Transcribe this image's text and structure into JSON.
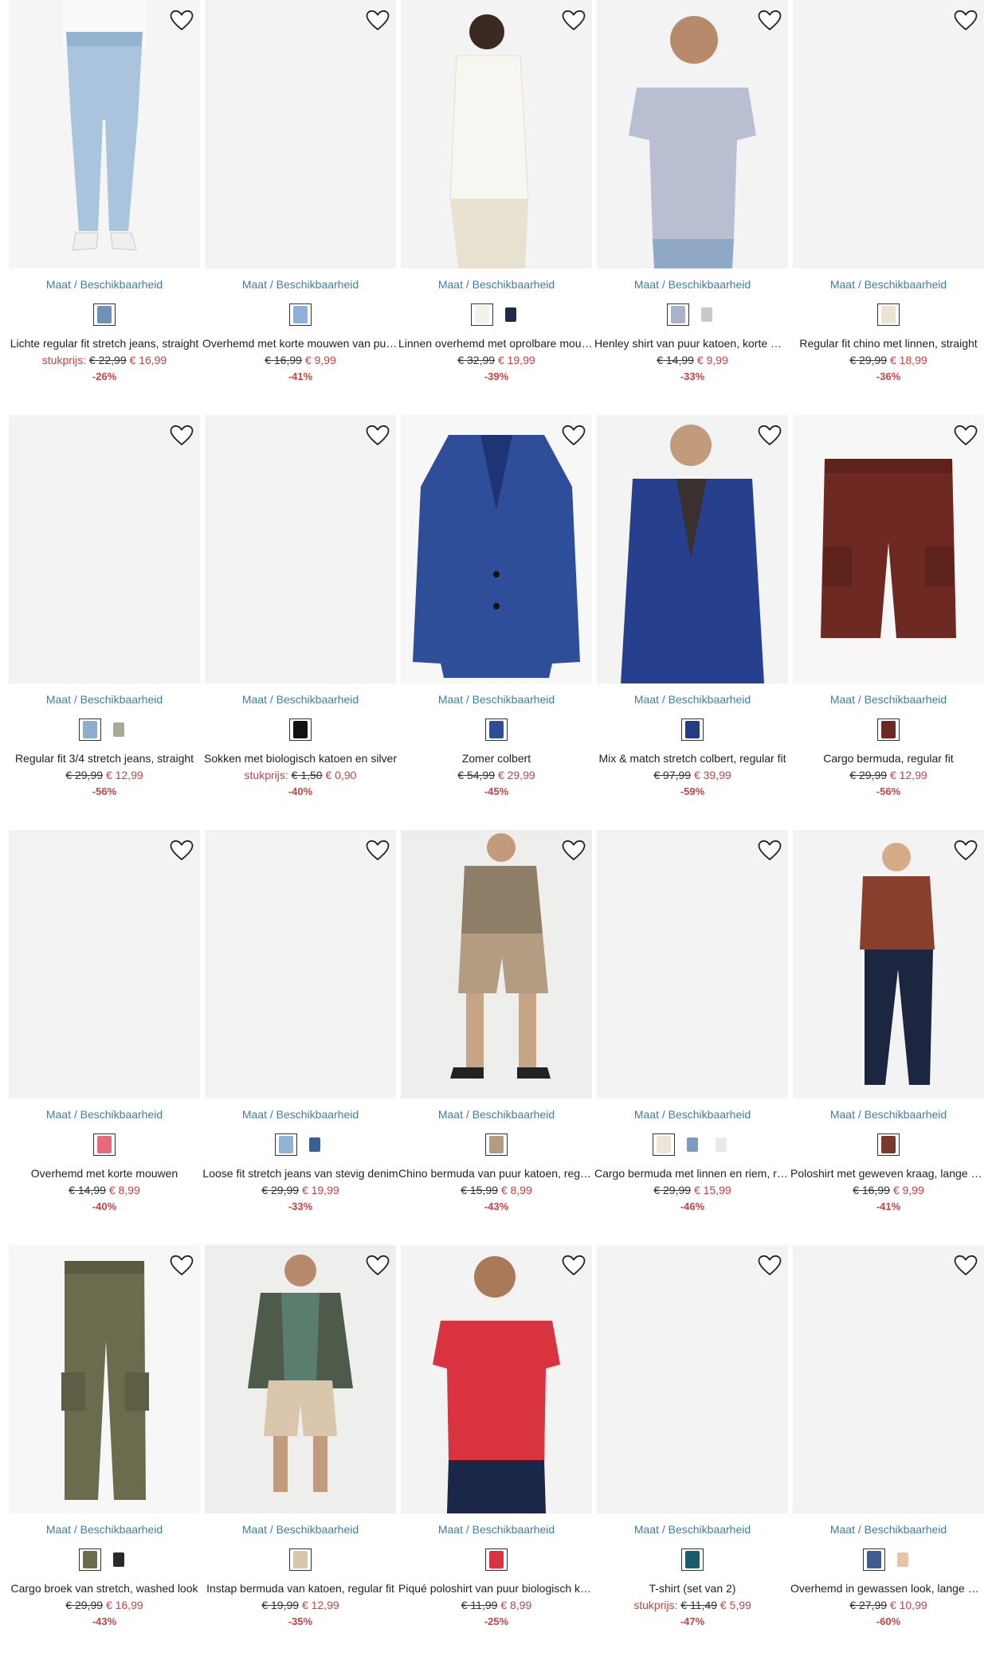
{
  "size_link_label": "Maat / Beschikbaarheid",
  "colors": {
    "link": "#3d7ea6",
    "sale": "#c14545",
    "placeholder": "#f3f3f3"
  },
  "products": [
    {
      "name": "Lichte regular fit stretch jeans, straight",
      "unit_label": "stukprijs:",
      "old_price": "€ 22,99",
      "new_price": "€ 16,99",
      "discount": "-26%",
      "image": "light-blue-jeans-model",
      "swatches": [
        "#6f92b8"
      ]
    },
    {
      "name": "Overhemd met korte mouwen van puur katoen",
      "unit_label": "",
      "old_price": "€ 16,99",
      "new_price": "€ 9,99",
      "discount": "-41%",
      "image": "placeholder",
      "swatches": [
        "#8fb0d8"
      ]
    },
    {
      "name": "Linnen overhemd met oprolbare mouwen",
      "unit_label": "",
      "old_price": "€ 32,99",
      "new_price": "€ 19,99",
      "discount": "-39%",
      "image": "white-linen-shirt-model",
      "swatches": [
        "#f4f1ea",
        "#1f2a44"
      ]
    },
    {
      "name": "Henley shirt van puur katoen, korte mouw",
      "unit_label": "",
      "old_price": "€ 14,99",
      "new_price": "€ 9,99",
      "discount": "-33%",
      "image": "grey-henley-model",
      "swatches": [
        "#a9b2c6",
        "#c9c9c9"
      ]
    },
    {
      "name": "Regular fit chino met linnen, straight",
      "unit_label": "",
      "old_price": "€ 29,99",
      "new_price": "€ 18,99",
      "discount": "-36%",
      "image": "placeholder",
      "swatches": [
        "#ece4d2"
      ]
    },
    {
      "name": "Regular fit 3/4 stretch jeans, straight",
      "unit_label": "",
      "old_price": "€ 29,99",
      "new_price": "€ 12,99",
      "discount": "-56%",
      "image": "placeholder",
      "swatches": [
        "#8eaed0",
        "#a9aa98"
      ]
    },
    {
      "name": "Sokken met biologisch katoen en silver",
      "unit_label": "stukprijs:",
      "old_price": "€ 1,50",
      "new_price": "€ 0,90",
      "discount": "-40%",
      "image": "placeholder",
      "swatches": [
        "#111111"
      ]
    },
    {
      "name": "Zomer colbert",
      "unit_label": "",
      "old_price": "€ 54,99",
      "new_price": "€ 29,99",
      "discount": "-45%",
      "image": "blue-blazer",
      "swatches": [
        "#2e4d96"
      ]
    },
    {
      "name": "Mix & match stretch colbert, regular fit",
      "unit_label": "",
      "old_price": "€ 97,99",
      "new_price": "€ 39,99",
      "discount": "-59%",
      "image": "blue-suit-model",
      "swatches": [
        "#243c80"
      ]
    },
    {
      "name": "Cargo bermuda, regular fit",
      "unit_label": "",
      "old_price": "€ 29,99",
      "new_price": "€ 12,99",
      "discount": "-56%",
      "image": "brown-cargo-shorts",
      "swatches": [
        "#6e2a22"
      ]
    },
    {
      "name": "Overhemd met korte mouwen",
      "unit_label": "",
      "old_price": "€ 14,99",
      "new_price": "€ 8,99",
      "discount": "-40%",
      "image": "placeholder",
      "swatches": [
        "#e86a7a"
      ]
    },
    {
      "name": "Loose fit stretch jeans van stevig denim",
      "unit_label": "",
      "old_price": "€ 29,99",
      "new_price": "€ 19,99",
      "discount": "-33%",
      "image": "placeholder",
      "swatches": [
        "#8fb2d6",
        "#3a5f92"
      ]
    },
    {
      "name": "Chino bermuda van puur katoen, regular fit",
      "unit_label": "",
      "old_price": "€ 15,99",
      "new_price": "€ 8,99",
      "discount": "-43%",
      "image": "khaki-outfit-model",
      "swatches": [
        "#b49c82"
      ]
    },
    {
      "name": "Cargo bermuda met linnen en riem, regular",
      "unit_label": "",
      "old_price": "€ 29,99",
      "new_price": "€ 15,99",
      "discount": "-46%",
      "image": "placeholder",
      "swatches": [
        "#ece6d4",
        "#7d9ac0",
        "#e9e9e9"
      ]
    },
    {
      "name": "Poloshirt met geweven kraag, lange mouw",
      "unit_label": "",
      "old_price": "€ 16,99",
      "new_price": "€ 9,99",
      "discount": "-41%",
      "image": "rust-polo-model",
      "swatches": [
        "#7a3a2a"
      ]
    },
    {
      "name": "Cargo broek van stretch, washed look",
      "unit_label": "",
      "old_price": "€ 29,99",
      "new_price": "€ 16,99",
      "discount": "-43%",
      "image": "olive-cargo-pants",
      "swatches": [
        "#6b6b4e",
        "#2a2a2a"
      ]
    },
    {
      "name": "Instap bermuda van katoen, regular fit",
      "unit_label": "",
      "old_price": "€ 19,99",
      "new_price": "€ 12,99",
      "discount": "-35%",
      "image": "hoodie-shorts-model",
      "swatches": [
        "#d9c6ad"
      ]
    },
    {
      "name": "Piqué poloshirt van puur biologisch katoen",
      "unit_label": "",
      "old_price": "€ 11,99",
      "new_price": "€ 8,99",
      "discount": "-25%",
      "image": "red-polo-model",
      "swatches": [
        "#d93340"
      ]
    },
    {
      "name": "T-shirt (set van 2)",
      "unit_label": "stukprijs:",
      "old_price": "€ 11,49",
      "new_price": "€ 5,99",
      "discount": "-47%",
      "image": "placeholder",
      "swatches": [
        "#1b5b6a"
      ]
    },
    {
      "name": "Overhemd in gewassen look, lange mouw",
      "unit_label": "",
      "old_price": "€ 27,99",
      "new_price": "€ 10,99",
      "discount": "-60%",
      "image": "placeholder",
      "swatches": [
        "#3e5d8f",
        "#e6c4a8"
      ]
    }
  ]
}
